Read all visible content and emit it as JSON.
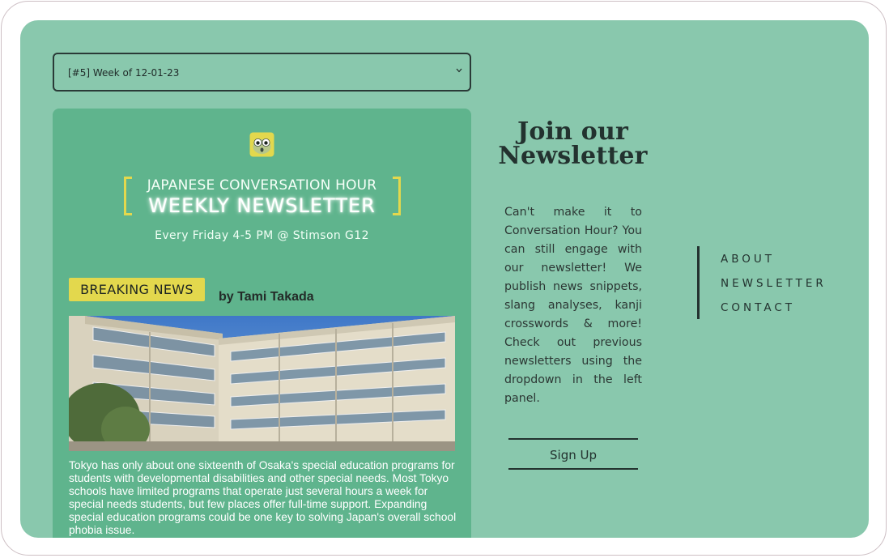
{
  "issue_selector": {
    "selected": "[#5] Week of 12-01-23"
  },
  "newsletter": {
    "header_line1": "JAPANESE CONVERSATION HOUR",
    "header_line2": "WEEKLY NEWSLETTER",
    "schedule": "Every Friday 4-5 PM @ Stimson G12",
    "badge": "BREAKING NEWS",
    "byline": "by Tami Takada",
    "article_text": "Tokyo has only about one sixteenth of Osaka's special education programs for students with developmental disabilities and other special needs. Most Tokyo schools have limited programs that operate just several hours a week for special needs students, but few places offer full-time support. Expanding special education programs could be one key to solving Japan's overall school phobia issue."
  },
  "join": {
    "title": "Join our Newsletter",
    "body": "Can't make it to Conversation Hour? You can still engage with our newsletter! We publish news snippets, slang analyses, kanji crosswords & more! Check out previous newsletters using the dropdown in the left panel.",
    "signup_label": "Sign Up"
  },
  "nav": {
    "items": [
      "ABOUT",
      "NEWSLETTER",
      "CONTACT"
    ]
  },
  "colors": {
    "background": "#89c8ad",
    "card": "#5fb48d",
    "accent_yellow": "#e3d84d",
    "text_dark": "#23322f"
  },
  "icons": {
    "dropdown": "chevron-down-icon",
    "mascot": "frog-mascot-icon"
  }
}
